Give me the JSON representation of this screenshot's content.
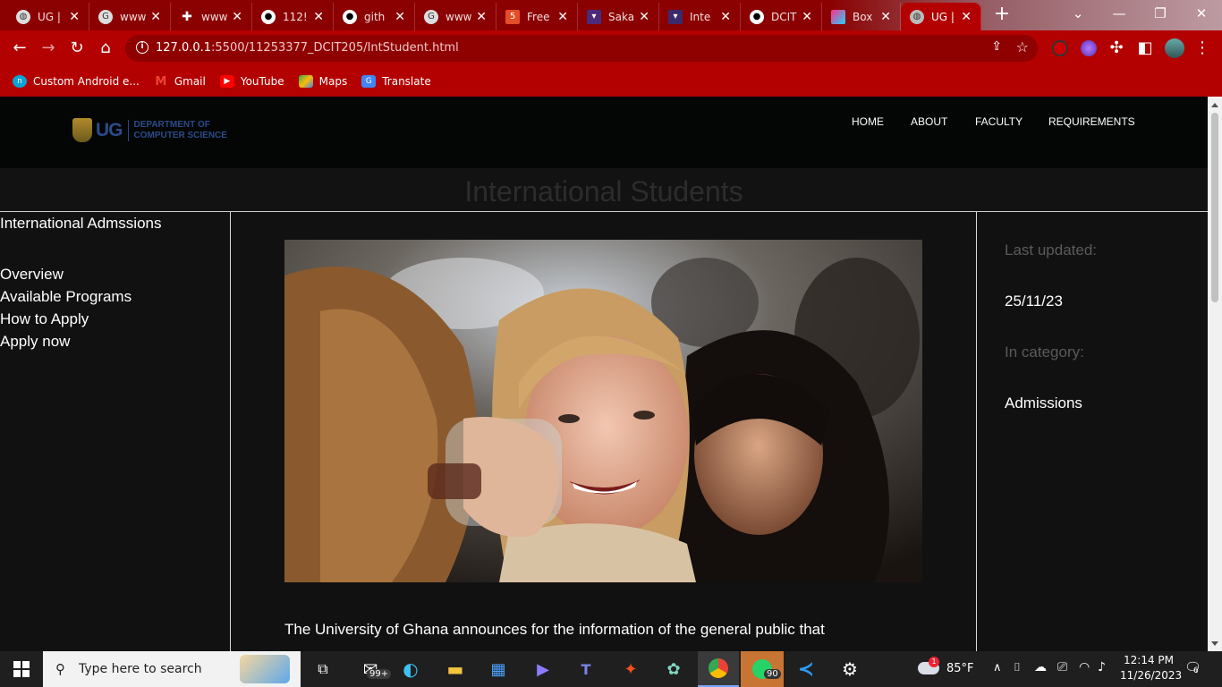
{
  "browser": {
    "tabs": [
      {
        "title": "UG |",
        "icon": "globe-icon",
        "active": false
      },
      {
        "title": "www",
        "icon": "google-icon",
        "active": false
      },
      {
        "title": "www",
        "icon": "plus-icon",
        "active": false
      },
      {
        "title": "112!",
        "icon": "github-icon",
        "active": false
      },
      {
        "title": "gith",
        "icon": "github-icon",
        "active": false
      },
      {
        "title": "www",
        "icon": "google-icon",
        "active": false
      },
      {
        "title": "Free",
        "icon": "html5-icon",
        "active": false
      },
      {
        "title": "Saka",
        "icon": "crest-icon",
        "active": false
      },
      {
        "title": "Inte",
        "icon": "crest-icon",
        "active": false
      },
      {
        "title": "DCIT",
        "icon": "github-icon",
        "active": false
      },
      {
        "title": "Box",
        "icon": "cube-icon",
        "active": false
      },
      {
        "title": "UG |",
        "icon": "globe-icon",
        "active": true
      }
    ],
    "url_host": "127.0.0.1",
    "url_path": ":5500/11253377_DCIT205/IntStudent.html",
    "bookmarks": [
      "Custom Android e...",
      "Gmail",
      "YouTube",
      "Maps",
      "Translate"
    ],
    "colors": {
      "frame": "#8b0000",
      "toolbar": "#b30000"
    }
  },
  "site": {
    "logo_ug": "UG",
    "logo_dept_line1": "DEPARTMENT OF",
    "logo_dept_line2": "COMPUTER SCIENCE",
    "nav": [
      "HOME",
      "ABOUT",
      "FACULTY",
      "REQUIREMENTS"
    ],
    "page_title": "International Students",
    "sidebar": {
      "heading": "International Admssions",
      "links": [
        "Overview",
        "Available Programs",
        "How to Apply",
        "Apply now"
      ]
    },
    "body_text": "The University of Ghana announces for the information of the general public that",
    "meta": {
      "updated_label": "Last updated:",
      "updated_value": "25/11/23",
      "category_label": "In category:",
      "category_value": "Admissions"
    }
  },
  "taskbar": {
    "search_placeholder": "Type here to search",
    "mail_badge": "99+",
    "whatsapp_badge": "90",
    "weather_temp": "85°F",
    "weather_alert": "1",
    "time": "12:14 PM",
    "date": "11/26/2023",
    "notifications": "6"
  }
}
